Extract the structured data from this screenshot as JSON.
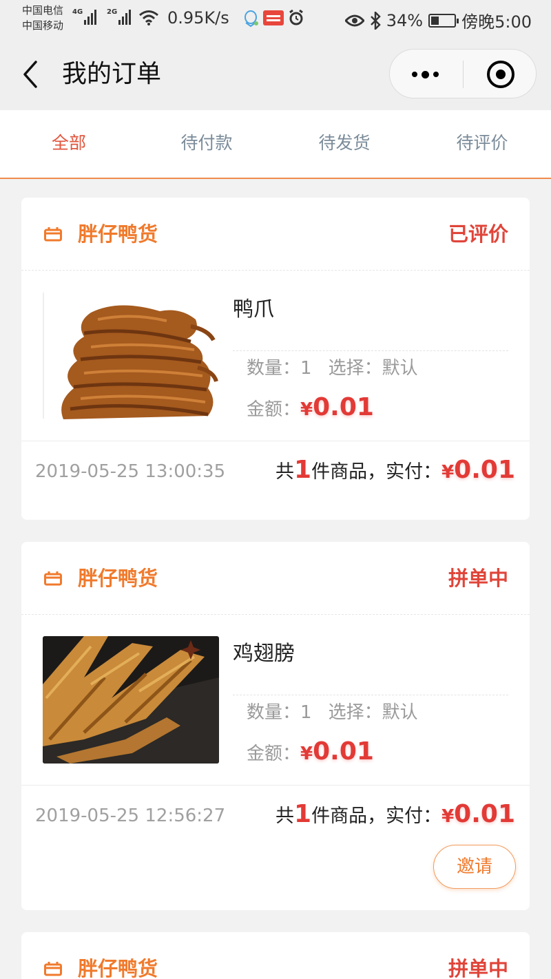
{
  "status_bar": {
    "carrier_1": "中国电信",
    "carrier_2": "中国移动",
    "net_1": "4G",
    "net_2": "2G",
    "speed": "0.95K/s",
    "battery": "34%",
    "battery_level": 0.34,
    "time": "傍晚5:00"
  },
  "nav": {
    "title": "我的订单"
  },
  "tabs": [
    {
      "label": "全部",
      "active": true
    },
    {
      "label": "待付款",
      "active": false
    },
    {
      "label": "待发货",
      "active": false
    },
    {
      "label": "待评价",
      "active": false
    }
  ],
  "labels": {
    "quantity": "数量：",
    "option": "选择：",
    "amount": "金额：",
    "yen": "¥",
    "total_prefix": "共",
    "total_mid": "件商品，实付：",
    "invite": "邀请"
  },
  "orders": [
    {
      "shop": "胖仔鸭货",
      "status": "已评价",
      "product": "鸭爪",
      "quantity": "1",
      "option": "默认",
      "amount": "0.01",
      "time": "2019-05-25 13:00:35",
      "count": "1",
      "paid": "0.01",
      "image": "duck-feet-photo"
    },
    {
      "shop": "胖仔鸭货",
      "status": "拼单中",
      "product": "鸡翅膀",
      "quantity": "1",
      "option": "默认",
      "amount": "0.01",
      "time": "2019-05-25 12:56:27",
      "count": "1",
      "paid": "0.01",
      "image": "chicken-wings-photo"
    },
    {
      "shop": "胖仔鸭货",
      "status": "拼单中"
    }
  ],
  "colors": {
    "accent_orange": "#f07a2c",
    "price_red": "#e23a36",
    "tab_active": "#e0553d"
  }
}
